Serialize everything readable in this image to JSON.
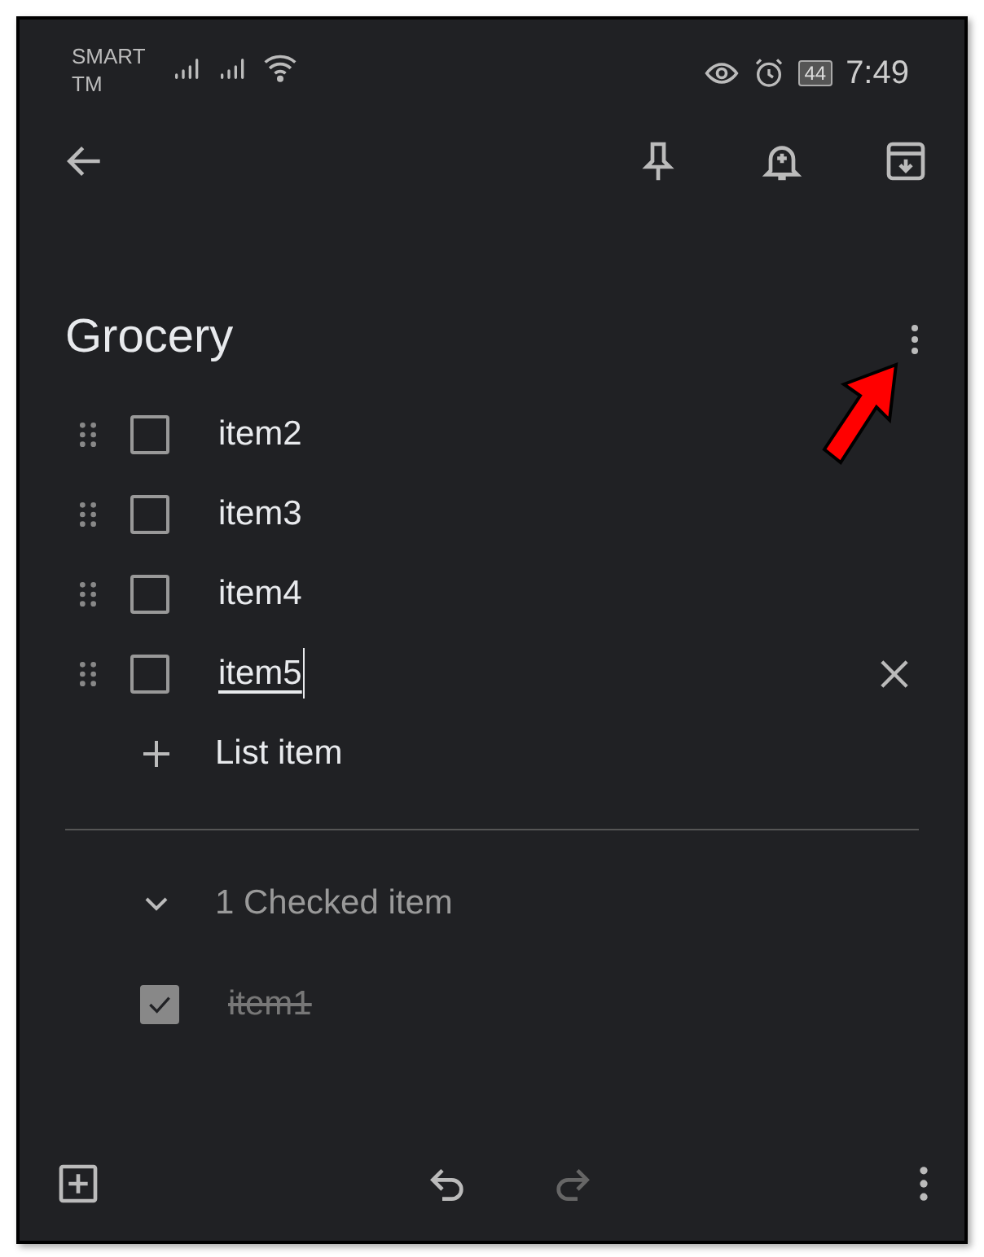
{
  "status_bar": {
    "carrier": [
      "SMART",
      "TM"
    ],
    "battery": "44",
    "time": "7:49"
  },
  "title": "Grocery",
  "items": [
    {
      "text": "item2",
      "checked": false,
      "focused": false
    },
    {
      "text": "item3",
      "checked": false,
      "focused": false
    },
    {
      "text": "item4",
      "checked": false,
      "focused": false
    },
    {
      "text": "item5",
      "checked": false,
      "focused": true
    }
  ],
  "add_item": "List item",
  "checked_section": {
    "label": "1 Checked item",
    "expanded": true
  },
  "checked_items": [
    {
      "text": "item1",
      "checked": true
    }
  ],
  "bottom_bar": [
    {
      "kind": "add",
      "disabled": false
    },
    {
      "kind": "undo",
      "disabled": false
    },
    {
      "kind": "redo",
      "disabled": true
    },
    {
      "kind": "more",
      "disabled": false
    }
  ]
}
